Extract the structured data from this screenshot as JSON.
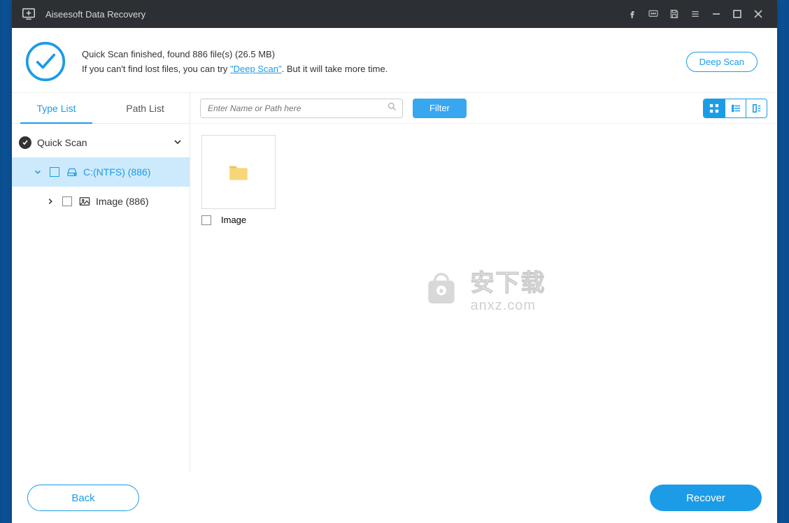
{
  "titlebar": {
    "title": "Aiseesoft Data Recovery"
  },
  "summary": {
    "line1": "Quick Scan finished, found 886 file(s) (26.5 MB)",
    "line2_pre": "If you can't find lost files, you can try ",
    "deep_link": "\"Deep Scan\"",
    "line2_post": ". But it will take more time.",
    "deep_scan_btn": "Deep Scan"
  },
  "tabs": {
    "type_list": "Type List",
    "path_list": "Path List"
  },
  "tree": {
    "quick_scan": "Quick Scan",
    "drive": "C:(NTFS) (886)",
    "image": "Image (886)"
  },
  "toolbar": {
    "search_placeholder": "Enter Name or Path here",
    "filter": "Filter"
  },
  "content": {
    "thumb_label": "Image"
  },
  "watermark": {
    "cn": "安下载",
    "en": "anxz.com"
  },
  "footer": {
    "back": "Back",
    "recover": "Recover"
  }
}
